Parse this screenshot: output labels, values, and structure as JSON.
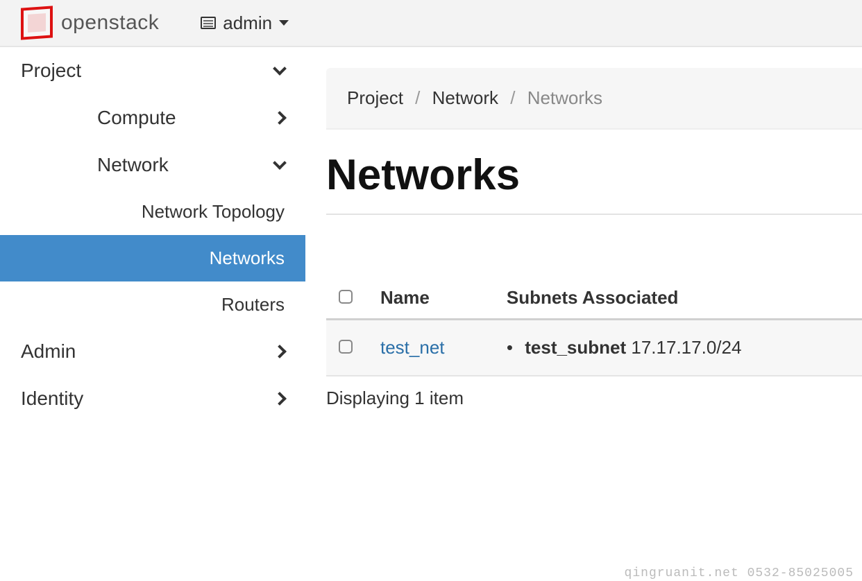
{
  "header": {
    "brand": "openstack",
    "project_switcher": "admin"
  },
  "sidebar": {
    "project": "Project",
    "compute": "Compute",
    "network": "Network",
    "network_topology": "Network Topology",
    "networks": "Networks",
    "routers": "Routers",
    "admin": "Admin",
    "identity": "Identity"
  },
  "breadcrumb": {
    "a": "Project",
    "b": "Network",
    "c": "Networks"
  },
  "page": {
    "title": "Networks"
  },
  "table": {
    "col_name": "Name",
    "col_subnets": "Subnets Associated",
    "rows": [
      {
        "name": "test_net",
        "subnet_name": "test_subnet",
        "subnet_cidr": "17.17.17.0/24"
      }
    ],
    "footer": "Displaying 1 item"
  },
  "watermark": "qingruanit.net 0532-85025005"
}
